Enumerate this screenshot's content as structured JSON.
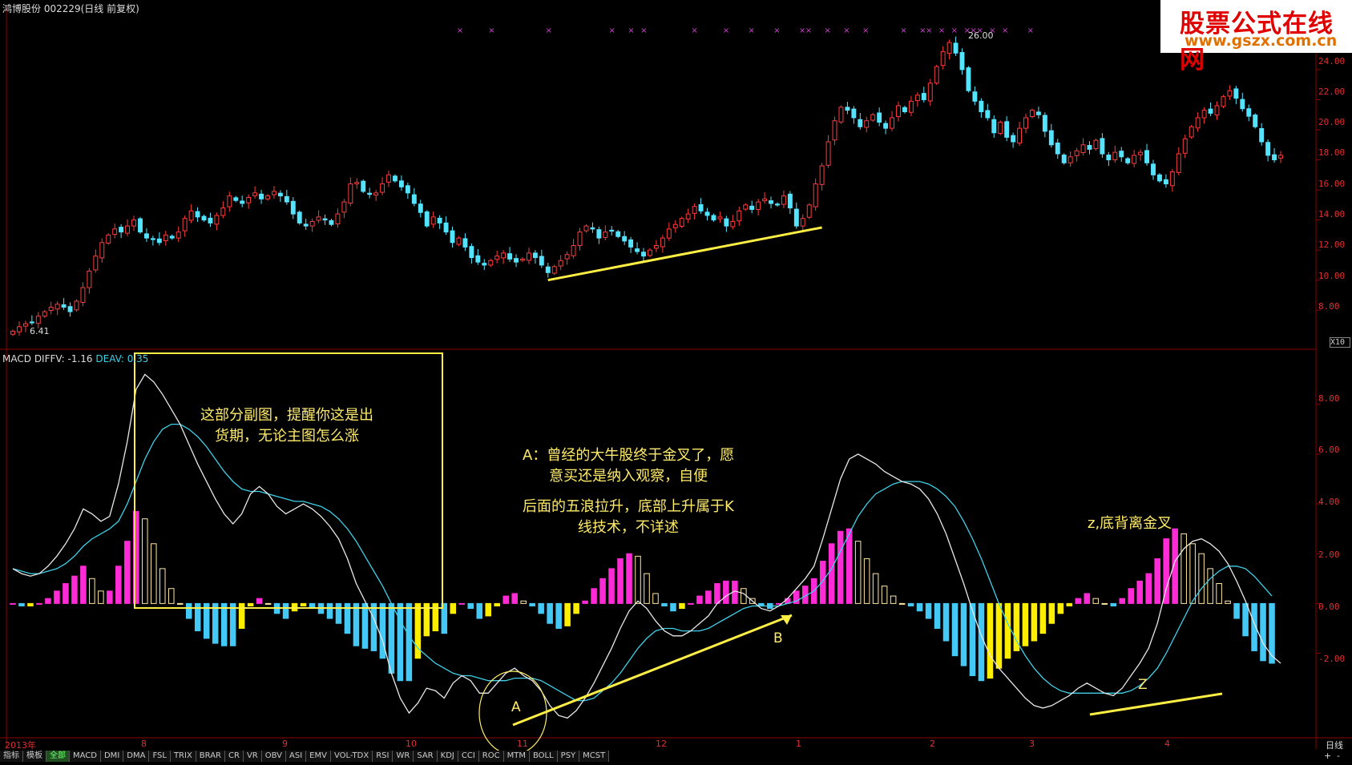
{
  "header": {
    "title": "鸿博股份 002229(日线 前复权)",
    "logo_cn": "股票公式在线网",
    "logo_url": "www.gszx.com.cn"
  },
  "price_panel": {
    "yaxis": [
      "24.00",
      "22.00",
      "20.00",
      "18.00",
      "16.00",
      "14.00",
      "12.00",
      "10.00",
      "8.00"
    ],
    "yaxis_values": [
      24,
      22,
      20,
      18,
      16,
      14,
      12,
      10,
      8
    ],
    "scale_tag": "X10",
    "high_label": "26.00",
    "low_label": "6.41",
    "colors": {
      "up": "#ff3b3b",
      "down": "#54e4ff",
      "signal_x": "#d040d0",
      "trend": "#ffee44"
    }
  },
  "macd_panel": {
    "name": "MACD",
    "diff_label": "DIFFV: -1.16",
    "deav_label": "DEAV: 0.35",
    "yaxis": [
      "8.00",
      "6.00",
      "4.00",
      "2.00",
      "0.00",
      "-2.00"
    ],
    "yaxis_values": [
      8,
      6,
      4,
      2,
      0,
      -2
    ]
  },
  "xaxis": {
    "year": "2013年",
    "months": [
      "8",
      "9",
      "10",
      "11",
      "12",
      "1",
      "2",
      "3",
      "4"
    ],
    "period": "日线"
  },
  "annotations": {
    "box_note": [
      "这部分副图，提醒你这是出",
      "货期，无论主图怎么涨"
    ],
    "note_a": [
      "A：曾经的大牛股终于金叉了，愿",
      "意买还是纳入观察，自便"
    ],
    "note_wave": [
      "后面的五浪拉升，底部上升属于K",
      "线技术，不详述"
    ],
    "note_z": "z,底背离金叉",
    "label_a": "A",
    "label_b": "B",
    "label_z": "Z"
  },
  "tabs": [
    "指标",
    "模板",
    "全部",
    "MACD",
    "DMI",
    "DMA",
    "FSL",
    "TRIX",
    "BRAR",
    "CR",
    "VR",
    "OBV",
    "ASI",
    "EMV",
    "VOL-TDX",
    "RSI",
    "WR",
    "SAR",
    "KDJ",
    "CCI",
    "ROC",
    "MTM",
    "BOLL",
    "PSY",
    "MCST"
  ],
  "active_tab": "全部",
  "bottom_right": [
    "+",
    "-"
  ],
  "chart_data": [
    {
      "type": "candlestick",
      "title": "鸿博股份 002229(日线 前复权)",
      "ylim": [
        7,
        26.5
      ],
      "series": [
        {
          "name": "close",
          "values": [
            6.6,
            6.9,
            7.1,
            7.2,
            7.6,
            7.9,
            8.2,
            8.4,
            8.2,
            7.9,
            8.6,
            9.5,
            10.6,
            11.6,
            12.5,
            13.0,
            13.4,
            13.2,
            13.6,
            14.0,
            13.2,
            12.8,
            12.7,
            12.5,
            13.0,
            12.8,
            13.2,
            14.1,
            14.6,
            14.2,
            14.0,
            13.8,
            14.3,
            14.8,
            15.6,
            15.3,
            15.1,
            15.5,
            15.8,
            15.4,
            15.6,
            15.9,
            15.6,
            15.2,
            14.4,
            13.8,
            13.6,
            13.9,
            14.2,
            14.0,
            13.7,
            14.4,
            15.2,
            16.4,
            16.5,
            15.9,
            15.7,
            15.8,
            16.4,
            17.0,
            16.6,
            16.2,
            15.8,
            15.1,
            14.5,
            13.6,
            14.2,
            13.8,
            13.2,
            12.5,
            12.8,
            12.2,
            11.5,
            11.2,
            11.0,
            11.3,
            11.6,
            11.8,
            11.4,
            11.2,
            11.4,
            11.8,
            11.5,
            11.0,
            10.5,
            10.9,
            11.3,
            11.7,
            12.3,
            13.2,
            13.6,
            13.4,
            12.8,
            13.2,
            13.3,
            12.9,
            12.6,
            12.2,
            11.9,
            11.6,
            12.0,
            12.3,
            12.8,
            13.4,
            13.7,
            14.1,
            14.4,
            14.9,
            14.6,
            14.3,
            14.0,
            14.2,
            13.6,
            13.9,
            14.6,
            15.0,
            14.7,
            15.2,
            15.4,
            15.1,
            15.0,
            15.6,
            14.8,
            13.6,
            14.1,
            15.0,
            16.4,
            17.6,
            19.2,
            20.6,
            21.5,
            21.3,
            20.8,
            20.2,
            20.6,
            21.0,
            20.5,
            20.1,
            20.8,
            21.6,
            21.2,
            21.9,
            22.3,
            22.0,
            23.1,
            24.2,
            25.2,
            25.8,
            25.1,
            24.0,
            22.6,
            21.9,
            21.2,
            20.8,
            19.8,
            20.5,
            19.5,
            19.2,
            20.1,
            20.8,
            21.3,
            21.0,
            19.9,
            19.0,
            18.4,
            17.8,
            18.2,
            18.6,
            19.0,
            18.7,
            19.3,
            18.4,
            18.0,
            18.5,
            18.2,
            17.8,
            18.3,
            18.5,
            17.8,
            17.0,
            16.6,
            16.4,
            17.2,
            18.4,
            19.4,
            20.2,
            20.8,
            21.3,
            21.1,
            21.6,
            22.2,
            22.6,
            22.1,
            21.4,
            20.9,
            20.2,
            19.2,
            18.3,
            18.0,
            18.3
          ]
        }
      ]
    },
    {
      "type": "macd",
      "title": "MACD",
      "ylim": [
        -5.2,
        9.6
      ],
      "series": [
        {
          "name": "DIFFV",
          "values": [
            1.4,
            1.2,
            1.1,
            1.2,
            1.5,
            1.9,
            2.4,
            3.0,
            3.8,
            3.6,
            3.3,
            3.5,
            4.8,
            6.5,
            8.6,
            9.2,
            8.9,
            8.4,
            7.8,
            7.2,
            6.4,
            5.6,
            4.9,
            4.2,
            3.6,
            3.2,
            3.6,
            4.4,
            4.7,
            4.4,
            3.9,
            3.6,
            3.8,
            4.0,
            3.8,
            3.5,
            3.1,
            2.6,
            1.8,
            0.8,
            0.1,
            -0.6,
            -1.5,
            -2.8,
            -3.8,
            -4.4,
            -4.0,
            -3.4,
            -3.5,
            -3.8,
            -3.2,
            -2.9,
            -3.1,
            -3.6,
            -3.6,
            -3.2,
            -2.8,
            -2.6,
            -2.9,
            -3.1,
            -3.5,
            -4.1,
            -4.5,
            -4.6,
            -4.3,
            -3.8,
            -3.2,
            -2.5,
            -1.8,
            -1.0,
            -0.3,
            0.1,
            -0.2,
            -0.7,
            -1.1,
            -1.3,
            -1.3,
            -1.1,
            -0.8,
            -0.5,
            0.0,
            0.3,
            0.5,
            0.4,
            0.1,
            -0.2,
            -0.3,
            -0.1,
            0.2,
            0.6,
            1.0,
            1.5,
            2.6,
            3.8,
            5.0,
            5.8,
            6.0,
            5.8,
            5.6,
            5.3,
            5.1,
            4.9,
            4.8,
            4.6,
            4.2,
            3.6,
            2.8,
            1.8,
            0.8,
            -0.3,
            -1.3,
            -2.1,
            -2.6,
            -3.0,
            -3.4,
            -3.8,
            -4.1,
            -4.2,
            -4.1,
            -3.9,
            -3.7,
            -3.4,
            -3.2,
            -3.4,
            -3.6,
            -3.7,
            -3.4,
            -2.9,
            -2.4,
            -1.8,
            -0.8,
            0.6,
            1.7,
            2.2,
            2.5,
            2.6,
            2.4,
            2.1,
            1.6,
            0.9,
            0.1,
            -0.8,
            -1.6,
            -2.1,
            -2.4
          ]
        },
        {
          "name": "DEAV",
          "values": [
            1.4,
            1.3,
            1.2,
            1.2,
            1.3,
            1.4,
            1.6,
            1.9,
            2.3,
            2.6,
            2.8,
            3.0,
            3.3,
            4.0,
            4.9,
            5.8,
            6.5,
            7.0,
            7.2,
            7.2,
            7.0,
            6.7,
            6.3,
            5.8,
            5.3,
            4.9,
            4.6,
            4.5,
            4.5,
            4.4,
            4.3,
            4.2,
            4.1,
            4.1,
            4.0,
            3.9,
            3.7,
            3.4,
            3.0,
            2.5,
            1.9,
            1.3,
            0.7,
            0.0,
            -0.7,
            -1.3,
            -1.8,
            -2.1,
            -2.4,
            -2.6,
            -2.8,
            -2.9,
            -2.9,
            -3.0,
            -3.1,
            -3.1,
            -3.1,
            -3.0,
            -3.0,
            -3.0,
            -3.1,
            -3.3,
            -3.5,
            -3.7,
            -3.9,
            -3.9,
            -3.8,
            -3.5,
            -3.2,
            -2.8,
            -2.3,
            -1.8,
            -1.4,
            -1.1,
            -1.0,
            -1.0,
            -1.1,
            -1.1,
            -1.1,
            -1.0,
            -0.8,
            -0.6,
            -0.4,
            -0.2,
            -0.1,
            -0.1,
            -0.1,
            -0.1,
            0.0,
            0.1,
            0.3,
            0.5,
            0.9,
            1.4,
            2.1,
            2.8,
            3.5,
            4.0,
            4.4,
            4.6,
            4.8,
            4.9,
            4.9,
            4.9,
            4.8,
            4.6,
            4.3,
            3.9,
            3.3,
            2.6,
            1.8,
            0.9,
            0.0,
            -0.8,
            -1.5,
            -2.1,
            -2.6,
            -3.0,
            -3.3,
            -3.5,
            -3.6,
            -3.6,
            -3.6,
            -3.6,
            -3.6,
            -3.6,
            -3.6,
            -3.5,
            -3.3,
            -3.0,
            -2.6,
            -2.0,
            -1.3,
            -0.6,
            0.1,
            0.6,
            1.0,
            1.3,
            1.5,
            1.5,
            1.4,
            1.1,
            0.7,
            0.3
          ]
        }
      ]
    }
  ]
}
